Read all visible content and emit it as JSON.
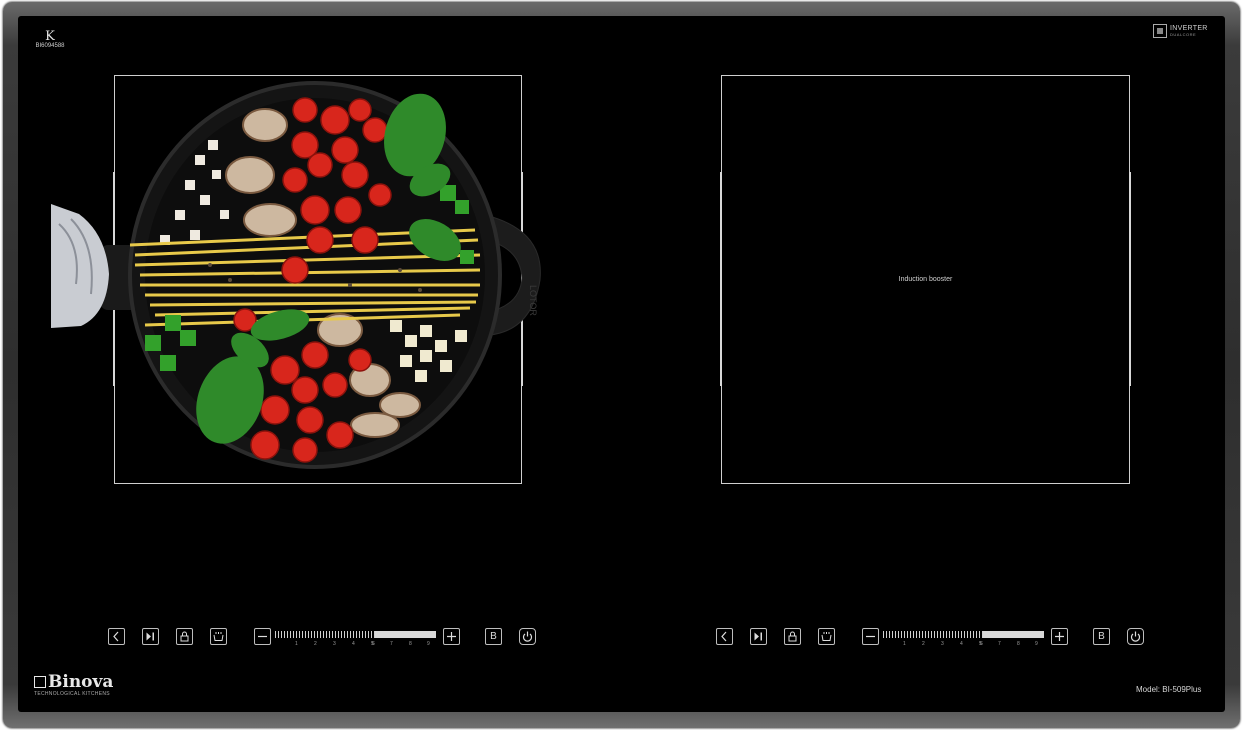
{
  "brand_top_left": {
    "mark": "K",
    "code": "BI6094588"
  },
  "brand_top_right": {
    "title": "INVERTER",
    "subtitle": "DUALCORE"
  },
  "right_zone": {
    "label": "Induction booster"
  },
  "pan": {
    "handle_text": "LOTOR"
  },
  "controls": {
    "b_label": "B",
    "scale": [
      "1",
      "2",
      "3",
      "4",
      "5",
      "6",
      "7",
      "8",
      "9"
    ],
    "left_level": 0.62,
    "right_level": 0.62
  },
  "logo": {
    "name": "Binova",
    "tagline": "TECHNOLOGICAL KITCHENS"
  },
  "model": "Model: BI-509Plus",
  "colors": {
    "glass": "#000000",
    "frame": "#3a3a3a",
    "tomato": "#d8261c",
    "basil": "#2f8a2a",
    "pasta": "#e7c94a"
  }
}
